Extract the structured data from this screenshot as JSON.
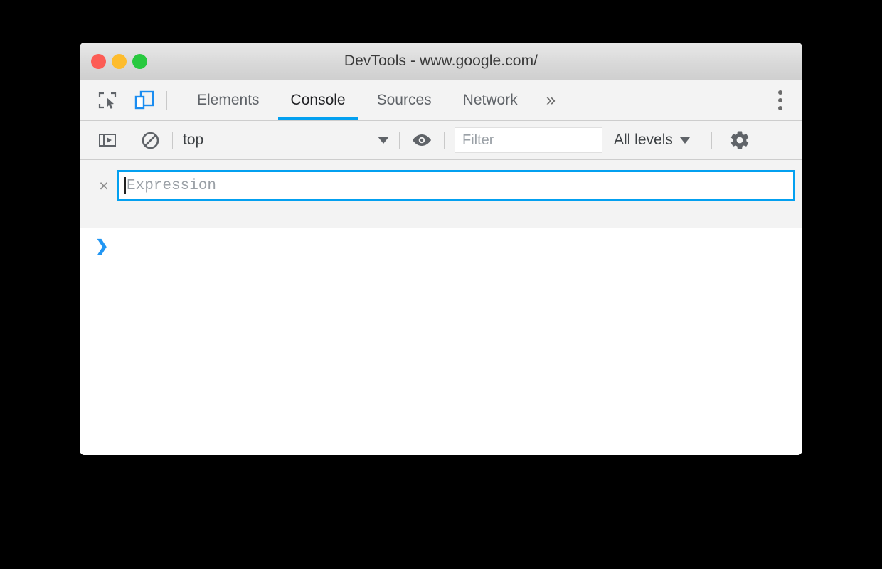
{
  "window": {
    "title": "DevTools - www.google.com/",
    "traffic_lights": [
      {
        "name": "close",
        "color": "#fc5c55"
      },
      {
        "name": "minimize",
        "color": "#fdbc2d"
      },
      {
        "name": "zoom",
        "color": "#28c93f"
      }
    ]
  },
  "tabbar": {
    "inspect_icon": "inspect-element-icon",
    "device_icon": "device-toolbar-icon",
    "tabs": [
      {
        "label": "Elements",
        "active": false
      },
      {
        "label": "Console",
        "active": true
      },
      {
        "label": "Sources",
        "active": false
      },
      {
        "label": "Network",
        "active": false
      }
    ],
    "more_tabs_label": "»",
    "menu_icon": "kebab-menu-icon",
    "active_underline_color": "#03a0f0"
  },
  "console_toolbar": {
    "sidebar_toggle_icon": "console-sidebar-icon",
    "clear_icon": "clear-console-icon",
    "context": "top",
    "eye_icon": "live-expression-eye-icon",
    "filter_placeholder": "Filter",
    "filter_value": "",
    "levels_label": "All levels",
    "settings_icon": "settings-gear-icon"
  },
  "live_expression": {
    "close_label": "×",
    "placeholder": "Expression",
    "value": "",
    "border_color": "#03a0f0"
  },
  "console_output": {
    "prompt": "❯"
  }
}
